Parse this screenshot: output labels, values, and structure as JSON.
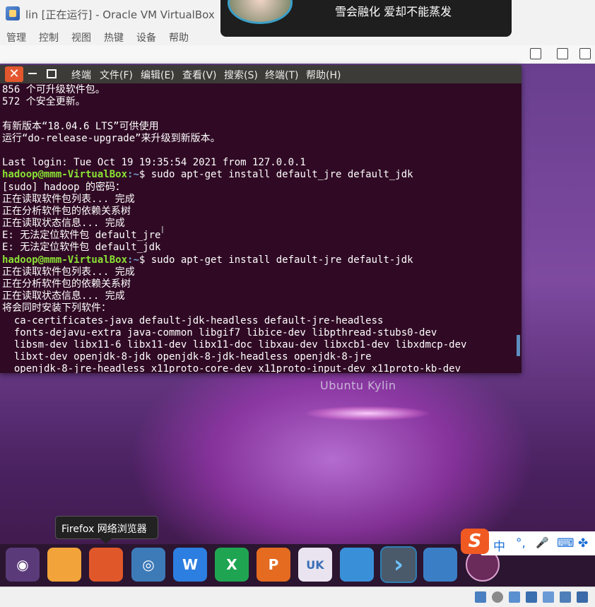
{
  "window": {
    "title": "lin [正在运行] - Oracle VM VirtualBox"
  },
  "vbox_menu": [
    "管理",
    "控制",
    "视图",
    "热键",
    "设备",
    "帮助"
  ],
  "notification": {
    "text": "雪会融化 爱却不能蒸发"
  },
  "desktop": {
    "brand": "Ubuntu Kylin"
  },
  "terminal": {
    "menu": [
      "终端",
      "文件(F)",
      "编辑(E)",
      "查看(V)",
      "搜索(S)",
      "终端(T)",
      "帮助(H)"
    ],
    "close_glyph": "✕",
    "lines": [
      {
        "text": "856 个可升级软件包。"
      },
      {
        "text": "572 个安全更新。"
      },
      {
        "text": ""
      },
      {
        "text": "有新版本“18.04.6 LTS”可供使用"
      },
      {
        "text": "运行“do-release-upgrade”来升级到新版本。"
      },
      {
        "text": ""
      },
      {
        "text": "Last login: Tue Oct 19 19:35:54 2021 from 127.0.0.1"
      },
      {
        "user": "hadoop@mmm-VirtualBox",
        "path": ":~",
        "cmd": "$ sudo apt-get install default_jre default_jdk"
      },
      {
        "text": "[sudo] hadoop 的密码："
      },
      {
        "text": "正在读取软件包列表... 完成"
      },
      {
        "text": "正在分析软件包的依赖关系树"
      },
      {
        "text": "正在读取状态信息... 完成"
      },
      {
        "text": "E: 无法定位软件包 default_jre"
      },
      {
        "text": "E: 无法定位软件包 default_jdk"
      },
      {
        "user": "hadoop@mmm-VirtualBox",
        "path": ":~",
        "cmd": "$ sudo apt-get install default-jre default-jdk"
      },
      {
        "text": "正在读取软件包列表... 完成"
      },
      {
        "text": "正在分析软件包的依赖关系树"
      },
      {
        "text": "正在读取状态信息... 完成"
      },
      {
        "text": "将会同时安装下列软件："
      },
      {
        "text": "  ca-certificates-java default-jdk-headless default-jre-headless"
      },
      {
        "text": "  fonts-dejavu-extra java-common libgif7 libice-dev libpthread-stubs0-dev"
      },
      {
        "text": "  libsm-dev libx11-6 libx11-dev libx11-doc libxau-dev libxcb1-dev libxdmcp-dev"
      },
      {
        "text": "  libxt-dev openjdk-8-jdk openjdk-8-jdk-headless openjdk-8-jre"
      },
      {
        "text": "  openjdk-8-jre-headless x11proto-core-dev x11proto-input-dev x11proto-kb-dev"
      }
    ]
  },
  "tooltip": {
    "text": "Firefox 网络浏览器"
  },
  "dock": [
    {
      "name": "ubuntu-kylin-menu",
      "glyph": "◉",
      "color": "#5b3a7a"
    },
    {
      "name": "files",
      "glyph": "",
      "color": "#f2a43a"
    },
    {
      "name": "firefox",
      "glyph": "",
      "color": "#e0582a"
    },
    {
      "name": "browser",
      "glyph": "◎",
      "color": "#3d7ab8"
    },
    {
      "name": "wps-writer",
      "glyph": "W",
      "color": "#2c7ee0"
    },
    {
      "name": "wps-spreadsheet",
      "glyph": "X",
      "color": "#1fa552"
    },
    {
      "name": "wps-presentation",
      "glyph": "P",
      "color": "#e46b20"
    },
    {
      "name": "software-center",
      "glyph": "UK",
      "color": "#e9e4ef"
    },
    {
      "name": "kylin-assistant",
      "glyph": "",
      "color": "#3a90d8"
    },
    {
      "name": "terminal",
      "glyph": "›",
      "color": "#4a5a6a"
    },
    {
      "name": "workspace-switcher",
      "glyph": "",
      "color": "#3a7fc6"
    },
    {
      "name": "media-disc",
      "glyph": "",
      "color": "#6a2a5a"
    }
  ],
  "ime": {
    "logo": "S",
    "lang": "中",
    "punct": "°,",
    "mic": "🎤",
    "keyboard": "⌨",
    "apps": "✤"
  }
}
